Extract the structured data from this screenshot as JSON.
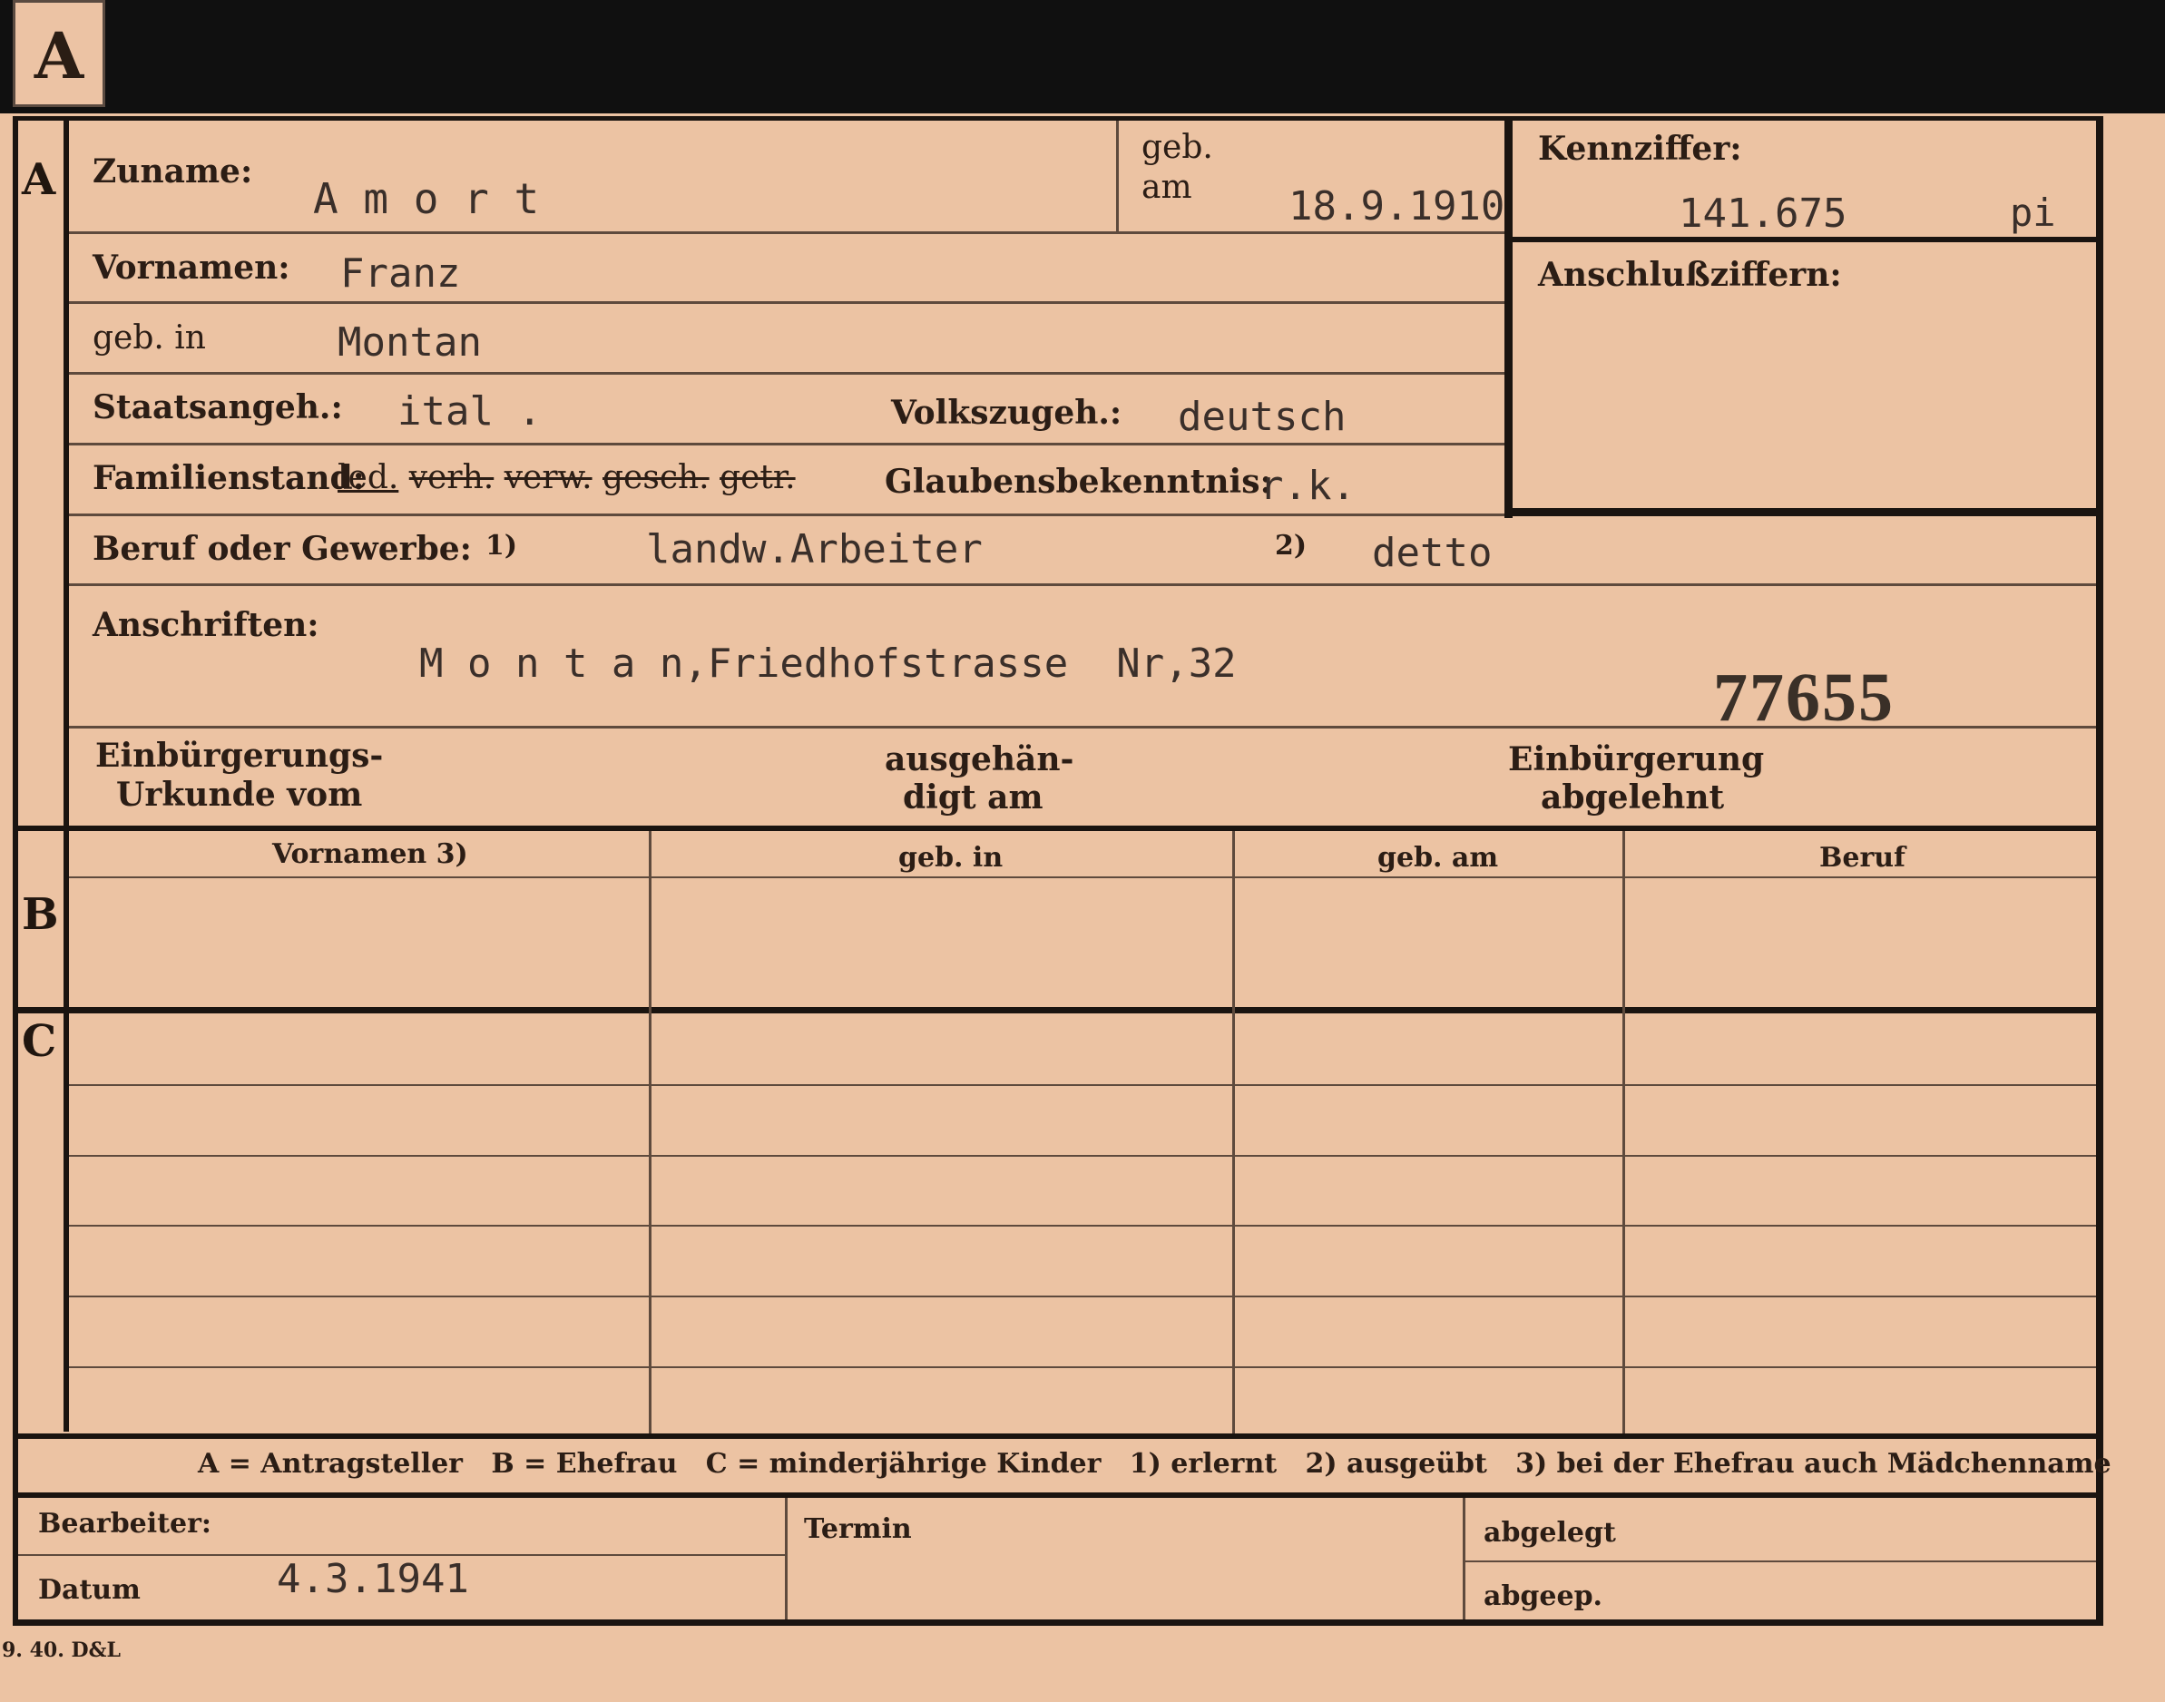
{
  "card_letter": "A",
  "section_letters": {
    "a": "A",
    "b": "B",
    "c": "C"
  },
  "row1": {
    "surname_label": "Zuname:",
    "surname": "A m o r t",
    "born_label_1": "geb.",
    "born_label_2": "am",
    "born_date": "18.9.1910",
    "id_label": "Kennziffer:",
    "id_number": "141.675",
    "id_suffix": "pi"
  },
  "connection_label": "Anschlußziffern:",
  "first_names_label": "Vornamen:",
  "first_names": "Franz",
  "birthplace_label": "geb. in",
  "birthplace": "Montan",
  "citizenship_label": "Staatsangeh.:",
  "citizenship": "ital .",
  "ethnicity_label": "Volkszugeh.:",
  "ethnicity": "deutsch",
  "marital_label": "Familienstand:",
  "marital_options": [
    "led.",
    "verh.",
    "verw.",
    "gesch.",
    "getr."
  ],
  "religion_label": "Glaubensbekenntnis:",
  "religion": "r.k.",
  "profession_label": "Beruf oder Gewerbe:",
  "profession_note_1": "1)",
  "profession_learned": "landw.Arbeiter",
  "profession_note_2": "2)",
  "profession_practiced": "detto",
  "address_label": "Anschriften:",
  "address": "M o n t a n,Friedhofstrasse  Nr,32",
  "stamp_number": "77655",
  "naturalization": {
    "col1_line1": "Einbürgerungs-",
    "col1_line2": "Urkunde vom",
    "col2_line1": "ausgehän-",
    "col2_line2": "digt am",
    "col3_line1": "Einbürgerung",
    "col3_line2": "abgelehnt"
  },
  "table_headers": [
    "Vornamen 3)",
    "geb. in",
    "geb. am",
    "Beruf"
  ],
  "legend": "A = Antragsteller   B = Ehefrau   C = minderjährige Kinder   1) erlernt   2) ausgeübt   3) bei der Ehefrau auch Mädchenname",
  "footer": {
    "clerk_label": "Bearbeiter:",
    "date_label": "Datum",
    "date": "4.3.1941",
    "deadline_label": "Termin",
    "filed_label": "abgelegt",
    "sent_label": "abgeер."
  },
  "print_code": "9. 40. D&L"
}
